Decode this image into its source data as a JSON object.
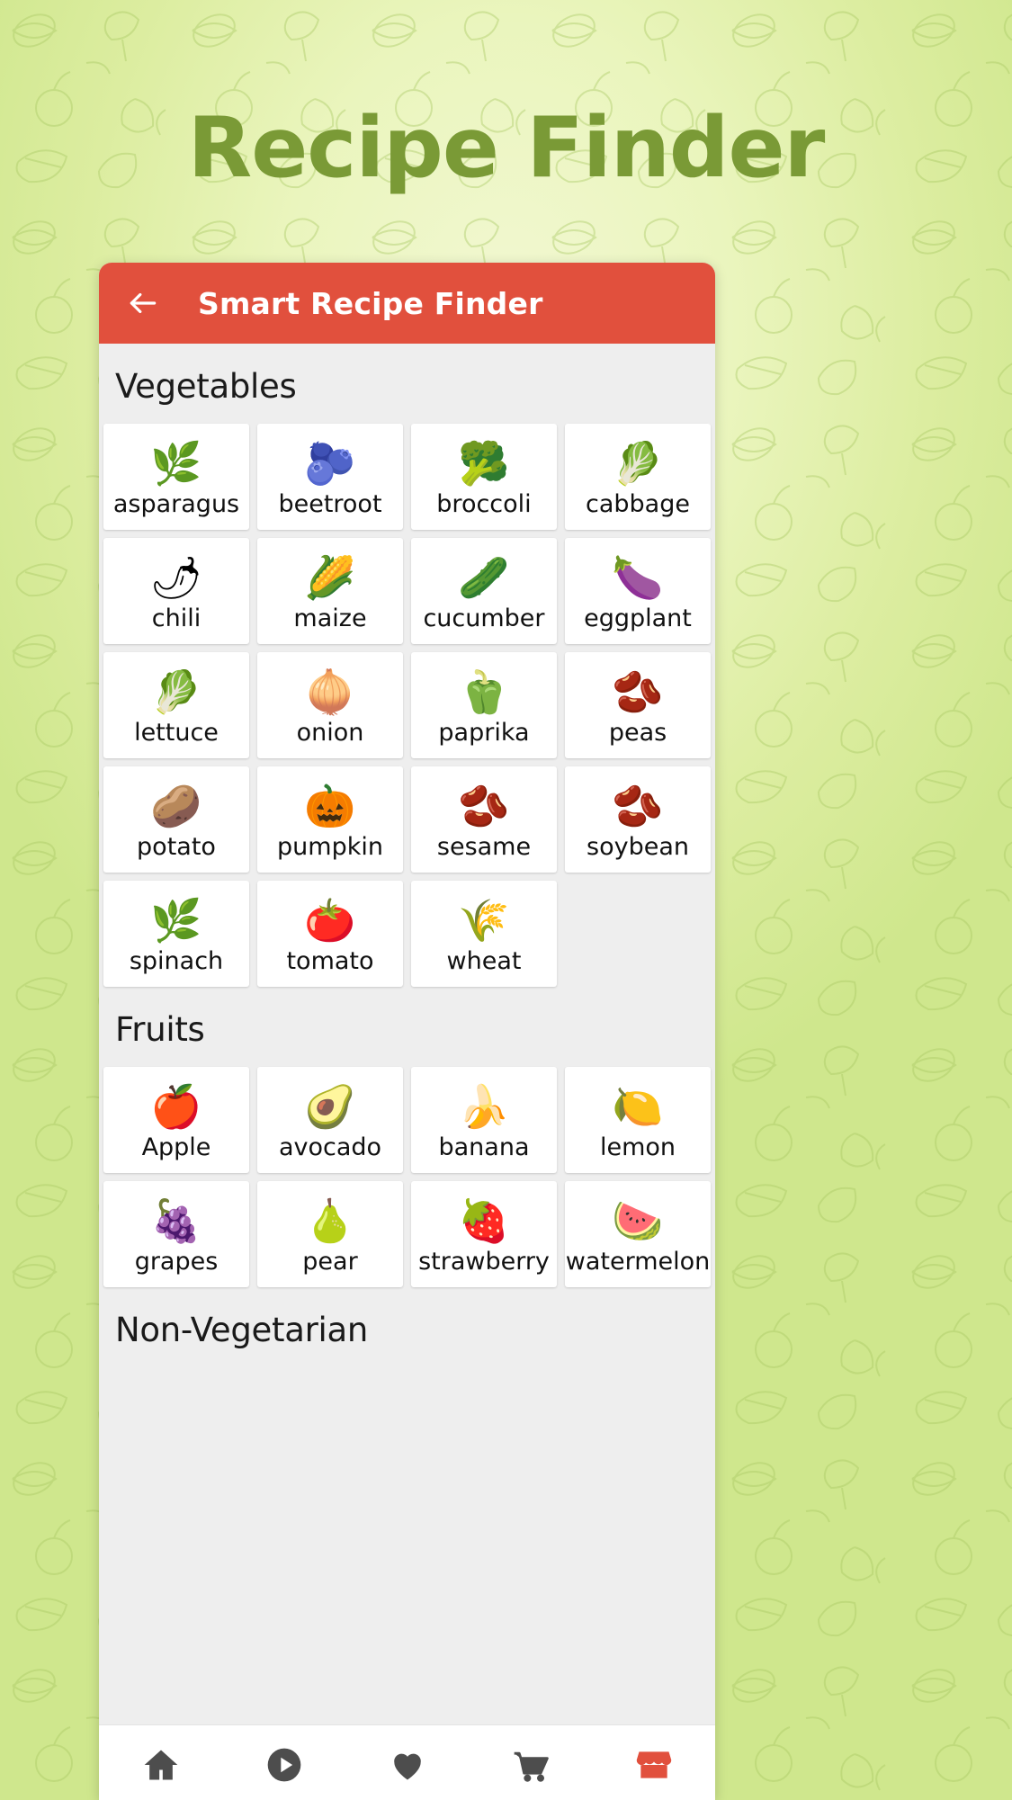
{
  "page": {
    "title": "Recipe Finder",
    "background_color": "#d8eb99",
    "title_color": "#7a9a36"
  },
  "appbar": {
    "title": "Smart Recipe Finder",
    "back_icon": "arrow-left-icon",
    "background_color": "#e1503d",
    "text_color": "#ffffff"
  },
  "sections": [
    {
      "id": "vegetables",
      "header": "Vegetables",
      "items": [
        {
          "label": "asparagus",
          "icon": "asparagus-icon",
          "emoji": "🌿"
        },
        {
          "label": "beetroot",
          "icon": "beetroot-icon",
          "emoji": "🫐"
        },
        {
          "label": "broccoli",
          "icon": "broccoli-icon",
          "emoji": "🥦"
        },
        {
          "label": "cabbage",
          "icon": "cabbage-icon",
          "emoji": "🥬"
        },
        {
          "label": "chili",
          "icon": "chili-icon",
          "emoji": "🌶"
        },
        {
          "label": "maize",
          "icon": "maize-icon",
          "emoji": "🌽"
        },
        {
          "label": "cucumber",
          "icon": "cucumber-icon",
          "emoji": "🥒"
        },
        {
          "label": "eggplant",
          "icon": "eggplant-icon",
          "emoji": "🍆"
        },
        {
          "label": "lettuce",
          "icon": "lettuce-icon",
          "emoji": "🥬"
        },
        {
          "label": "onion",
          "icon": "onion-icon",
          "emoji": "🧅"
        },
        {
          "label": "paprika",
          "icon": "paprika-icon",
          "emoji": "🫑"
        },
        {
          "label": "peas",
          "icon": "peas-icon",
          "emoji": "🫘"
        },
        {
          "label": "potato",
          "icon": "potato-icon",
          "emoji": "🥔"
        },
        {
          "label": "pumpkin",
          "icon": "pumpkin-icon",
          "emoji": "🎃"
        },
        {
          "label": "sesame",
          "icon": "sesame-icon",
          "emoji": "🫘"
        },
        {
          "label": "soybean",
          "icon": "soybean-icon",
          "emoji": "🫘"
        },
        {
          "label": "spinach",
          "icon": "spinach-icon",
          "emoji": "🌿"
        },
        {
          "label": "tomato",
          "icon": "tomato-icon",
          "emoji": "🍅"
        },
        {
          "label": "wheat",
          "icon": "wheat-icon",
          "emoji": "🌾"
        }
      ]
    },
    {
      "id": "fruits",
      "header": "Fruits",
      "items": [
        {
          "label": "Apple",
          "icon": "apple-icon",
          "emoji": "🍎"
        },
        {
          "label": "avocado",
          "icon": "avocado-icon",
          "emoji": "🥑"
        },
        {
          "label": "banana",
          "icon": "banana-icon",
          "emoji": "🍌"
        },
        {
          "label": "lemon",
          "icon": "lemon-icon",
          "emoji": "🍋"
        },
        {
          "label": "grapes",
          "icon": "grapes-icon",
          "emoji": "🍇"
        },
        {
          "label": "pear",
          "icon": "pear-icon",
          "emoji": "🍐"
        },
        {
          "label": "strawberry",
          "icon": "strawberry-icon",
          "emoji": "🍓"
        },
        {
          "label": "watermelon",
          "icon": "watermelon-icon",
          "emoji": "🍉"
        }
      ]
    },
    {
      "id": "non-vegetarian",
      "header": "Non-Vegetarian",
      "items": []
    }
  ],
  "bottom_nav": {
    "items": [
      {
        "icon": "home-icon",
        "color": "#4d4d4d"
      },
      {
        "icon": "play-circle-icon",
        "color": "#4d4d4d"
      },
      {
        "icon": "heart-icon",
        "color": "#4d4d4d"
      },
      {
        "icon": "cart-icon",
        "color": "#4d4d4d"
      },
      {
        "icon": "store-icon",
        "color": "#e1503d"
      }
    ]
  }
}
